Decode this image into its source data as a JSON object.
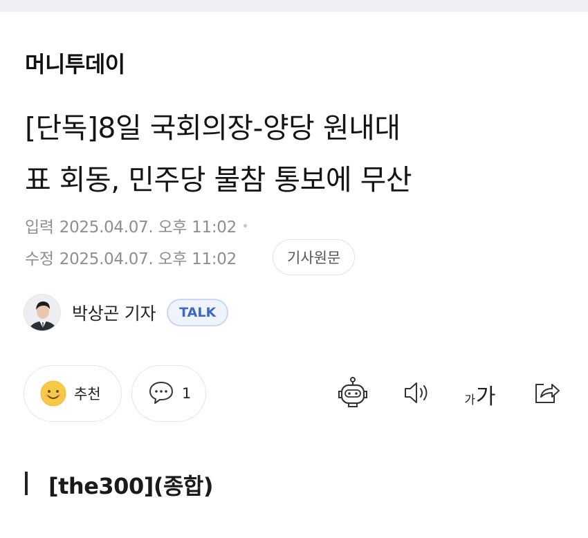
{
  "press": "머니투데이",
  "headline_line1": "[단독]8일 국회의장-양당 원내대",
  "headline_line2": "표 회동, 민주당 불참 통보에 무산",
  "meta": {
    "input_label": "입력",
    "input_date": "2025.04.07. 오후 11:02",
    "edit_label": "수정",
    "edit_date": "2025.04.07. 오후 11:02",
    "original_button": "기사원문"
  },
  "reporter": {
    "name": "박상곤 기자",
    "talk_badge": "TALK"
  },
  "actions": {
    "like_label": "추천",
    "comment_count": "1",
    "font_small": "가",
    "font_big": "가"
  },
  "section": "[the300](종합)",
  "icons": [
    "smile-icon",
    "comment-icon",
    "robot-icon",
    "speaker-icon",
    "font-size-icon",
    "share-icon"
  ],
  "colors": {
    "talk_accent": "#3f67c8",
    "smile": "#f7c948"
  }
}
